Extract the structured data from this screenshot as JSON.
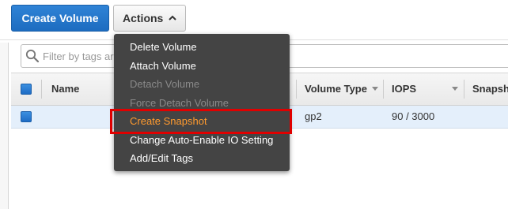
{
  "toolbar": {
    "create_volume_label": "Create Volume",
    "actions_label": "Actions"
  },
  "filter": {
    "placeholder": "Filter by tags ar"
  },
  "table": {
    "columns": [
      "Name",
      "Volume Type",
      "IOPS",
      "Snapsh"
    ],
    "rows": [
      {
        "name": "",
        "volume_type": "gp2",
        "iops": "90 / 3000",
        "snapshot": ""
      }
    ]
  },
  "actions_menu": {
    "items": [
      {
        "label": "Delete Volume",
        "enabled": true
      },
      {
        "label": "Attach Volume",
        "enabled": true
      },
      {
        "label": "Detach Volume",
        "enabled": false
      },
      {
        "label": "Force Detach Volume",
        "enabled": false
      },
      {
        "label": "Create Snapshot",
        "enabled": true,
        "highlighted": true
      },
      {
        "label": "Change Auto-Enable IO Setting",
        "enabled": true
      },
      {
        "label": "Add/Edit Tags",
        "enabled": true
      }
    ]
  },
  "colors": {
    "primary_button": "#1d6cc0",
    "menu_background": "#444444",
    "highlight_text": "#ff9a2e",
    "highlight_border": "#e00000",
    "selected_row": "#e4effb"
  },
  "icons": {
    "search": "search-icon",
    "actions_caret": "chevron-up-icon",
    "sort": "sort-down-icon"
  }
}
